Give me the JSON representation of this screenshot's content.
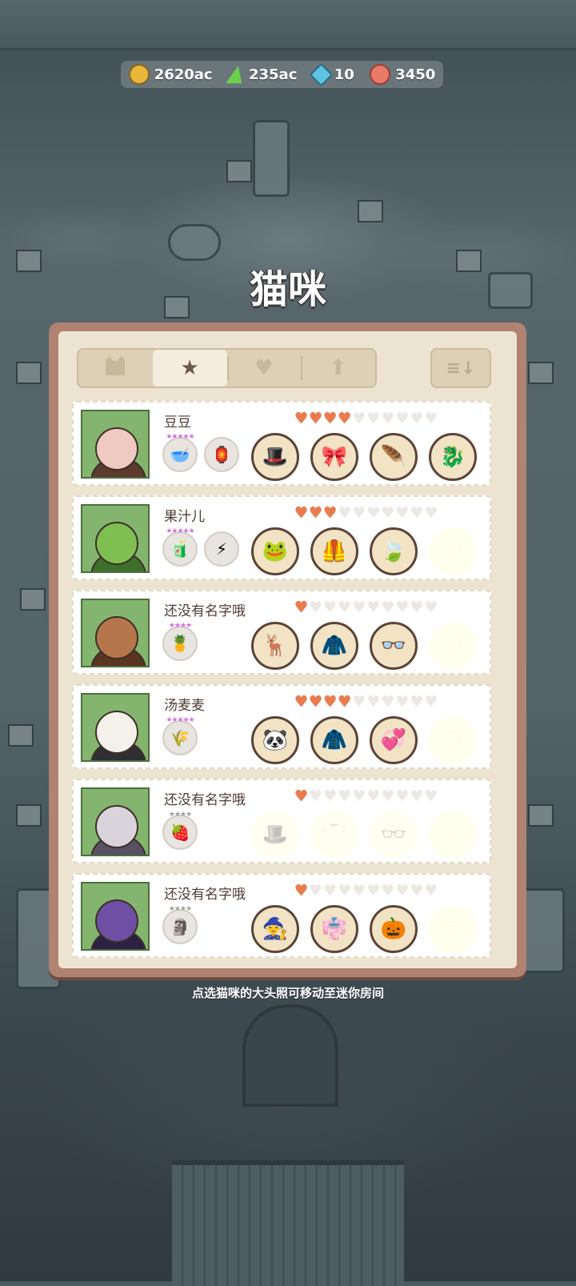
{
  "currency": {
    "coins": "2620ac",
    "energy": "235ac",
    "gems": "10",
    "yarn": "3450"
  },
  "page_title": "猫咪",
  "tabs": [
    {
      "icon": "cat-icon",
      "active": false
    },
    {
      "icon": "star-icon",
      "active": true
    },
    {
      "icon": "heart-icon",
      "active": false
    },
    {
      "icon": "arrow-up-icon",
      "active": false
    }
  ],
  "sort_icon": "sort-icon",
  "cats": [
    {
      "name": "豆豆",
      "hearts": 4,
      "hearts_max": 10,
      "avatar_colors": [
        "#f0c9c0",
        "#5c3a2e"
      ],
      "badges": [
        {
          "stars": "★★★★★",
          "icon": "🥣"
        },
        {
          "stars": "",
          "icon": "🏮"
        }
      ],
      "items": [
        "🎩",
        "🎀",
        "🪶",
        "🐉"
      ]
    },
    {
      "name": "果汁儿",
      "hearts": 3,
      "hearts_max": 10,
      "avatar_colors": [
        "#7fbf52",
        "#3f6f2c"
      ],
      "badges": [
        {
          "stars": "★★★★★",
          "icon": "🧃"
        },
        {
          "stars": "",
          "icon": "⚡"
        }
      ],
      "items": [
        "🐸",
        "🦺",
        "🍃",
        "locked"
      ]
    },
    {
      "name": "还没有名字哦",
      "hearts": 1,
      "hearts_max": 10,
      "avatar_colors": [
        "#b5764b",
        "#5a3520"
      ],
      "badges": [
        {
          "stars": "★★★★",
          "icon": "🍍"
        }
      ],
      "items": [
        "🦌",
        "🧥",
        "👓",
        "locked"
      ]
    },
    {
      "name": "汤麦麦",
      "hearts": 4,
      "hearts_max": 10,
      "avatar_colors": [
        "#f4f1ea",
        "#2f2f33"
      ],
      "badges": [
        {
          "stars": "★★★★★",
          "icon": "🌾"
        }
      ],
      "items": [
        "🐼",
        "🧥",
        "💞",
        "locked"
      ]
    },
    {
      "name": "还没有名字哦",
      "hearts": 1,
      "hearts_max": 10,
      "avatar_colors": [
        "#d9d3dc",
        "#585063"
      ],
      "badges": [
        {
          "stars": "★★★★",
          "icon": "🍓",
          "grey": true
        }
      ],
      "items": [
        "empty-hat",
        "empty-shirt",
        "empty-glasses",
        "locked"
      ]
    },
    {
      "name": "还没有名字哦",
      "hearts": 1,
      "hearts_max": 10,
      "avatar_colors": [
        "#6d4fa3",
        "#2c2142"
      ],
      "badges": [
        {
          "stars": "★★★★",
          "icon": "🗿",
          "grey": true
        }
      ],
      "items": [
        "🧙",
        "👘",
        "🎃",
        "locked"
      ]
    }
  ],
  "footer_tip": "点选猫咪的大头照可移动至迷你房间",
  "colors": {
    "panel_border": "#b08272",
    "panel_bg": "#ede3d1",
    "heart_on": "#ec7b4c",
    "avatar_bg": "#84b56e"
  }
}
